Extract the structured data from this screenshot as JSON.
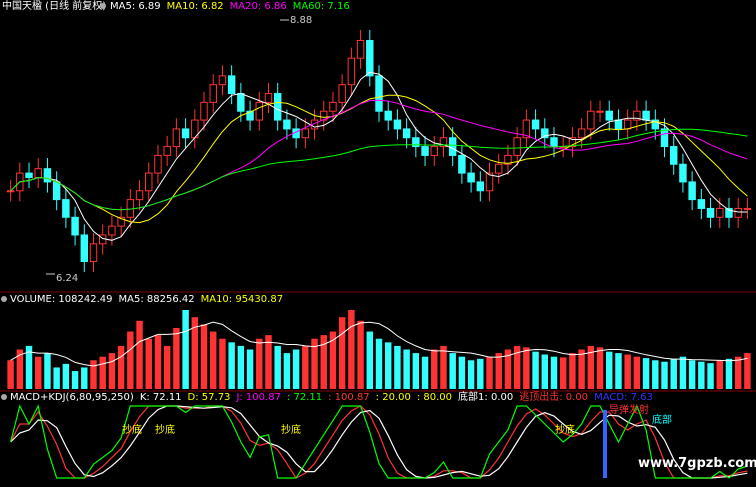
{
  "price_panel": {
    "title": "中国天楹 (日线 前复权)",
    "ma_items": [
      {
        "label": "MA5: 6.89",
        "color": "#ffffff"
      },
      {
        "label": "MA10: 6.82",
        "color": "#ffff00"
      },
      {
        "label": "MA20: 6.86",
        "color": "#ff00ff"
      },
      {
        "label": "MA60: 7.16",
        "color": "#00ff00"
      }
    ],
    "high_label": "8.88",
    "low_label": "6.24"
  },
  "volume_panel": {
    "items": [
      {
        "label": "VOLUME: 108242.49",
        "color": "#ffffff"
      },
      {
        "label": "MA5: 88256.42",
        "color": "#ffffff"
      },
      {
        "label": "MA10: 95430.87",
        "color": "#ffff00"
      }
    ]
  },
  "indicator_panel": {
    "items": [
      {
        "label": "MACD+KDJ(6,80,95,250)",
        "color": "#ffffff"
      },
      {
        "label": "K: 72.11",
        "color": "#ffffff"
      },
      {
        "label": "D: 57.73",
        "color": "#ffff00"
      },
      {
        "label": "J: 100.87",
        "color": "#ff00ff"
      },
      {
        "label": ": 72.11",
        "color": "#00ff00"
      },
      {
        "label": ": 100.87",
        "color": "#ff3333"
      },
      {
        "label": ": 20.00",
        "color": "#ffff00"
      },
      {
        "label": ": 80.00",
        "color": "#ffff00"
      },
      {
        "label": "底部1: 0.00",
        "color": "#ffffff"
      },
      {
        "label": "逃顶出击: 0.00",
        "color": "#ff3333"
      },
      {
        "label": "MACD: 7.63",
        "color": "#3333ff"
      }
    ],
    "annotations": [
      "抄底",
      "抄底",
      "抄底",
      "底部",
      "导弹发射",
      "抄底"
    ]
  },
  "watermark": "www.7gpzb.com",
  "chart_data": [
    {
      "type": "candlestick",
      "title": "中国天楹 (日线 前复权)",
      "close": [
        7.1,
        7.3,
        7.25,
        7.35,
        7.2,
        7.0,
        6.8,
        6.6,
        6.3,
        6.5,
        6.6,
        6.7,
        6.8,
        7.0,
        7.1,
        7.3,
        7.5,
        7.6,
        7.8,
        7.7,
        7.9,
        8.1,
        8.3,
        8.4,
        8.2,
        8.0,
        7.9,
        8.1,
        8.2,
        7.9,
        7.8,
        7.7,
        7.8,
        7.9,
        8.0,
        8.1,
        8.3,
        8.6,
        8.8,
        8.4,
        8.0,
        7.9,
        7.8,
        7.7,
        7.6,
        7.5,
        7.6,
        7.7,
        7.5,
        7.3,
        7.2,
        7.1,
        7.3,
        7.4,
        7.5,
        7.7,
        7.9,
        7.8,
        7.7,
        7.6,
        7.6,
        7.7,
        7.8,
        8.0,
        8.0,
        7.9,
        7.8,
        7.9,
        8.0,
        7.9,
        7.8,
        7.6,
        7.4,
        7.2,
        7.0,
        6.9,
        6.8,
        6.9,
        6.8,
        6.9,
        6.9
      ],
      "ma_values": {
        "MA5": 6.89,
        "MA10": 6.82,
        "MA20": 6.86,
        "MA60": 7.16
      },
      "max_price": 8.88,
      "min_price": 6.24
    },
    {
      "type": "bar",
      "title": "VOLUME",
      "values": [
        40,
        55,
        60,
        45,
        50,
        30,
        35,
        25,
        30,
        40,
        45,
        50,
        60,
        80,
        95,
        70,
        75,
        60,
        85,
        110,
        100,
        90,
        80,
        70,
        65,
        60,
        55,
        70,
        75,
        60,
        50,
        55,
        60,
        70,
        75,
        80,
        100,
        110,
        95,
        80,
        70,
        65,
        60,
        55,
        50,
        45,
        55,
        60,
        50,
        45,
        40,
        42,
        45,
        50,
        55,
        60,
        58,
        52,
        48,
        45,
        44,
        50,
        55,
        60,
        58,
        52,
        50,
        48,
        45,
        43,
        40,
        38,
        42,
        45,
        40,
        38,
        36,
        40,
        42,
        45,
        50
      ],
      "ma_values": {
        "VOLUME": 108242.49,
        "MA5": 88256.42,
        "MA10": 95430.87
      }
    },
    {
      "type": "line",
      "title": "MACD+KDJ(6,80,95,250)",
      "series_values": {
        "K": 72.11,
        "D": 57.73,
        "J": 100.87,
        "MACD": 7.63
      },
      "reference_levels": [
        20.0,
        80.0
      ]
    }
  ]
}
